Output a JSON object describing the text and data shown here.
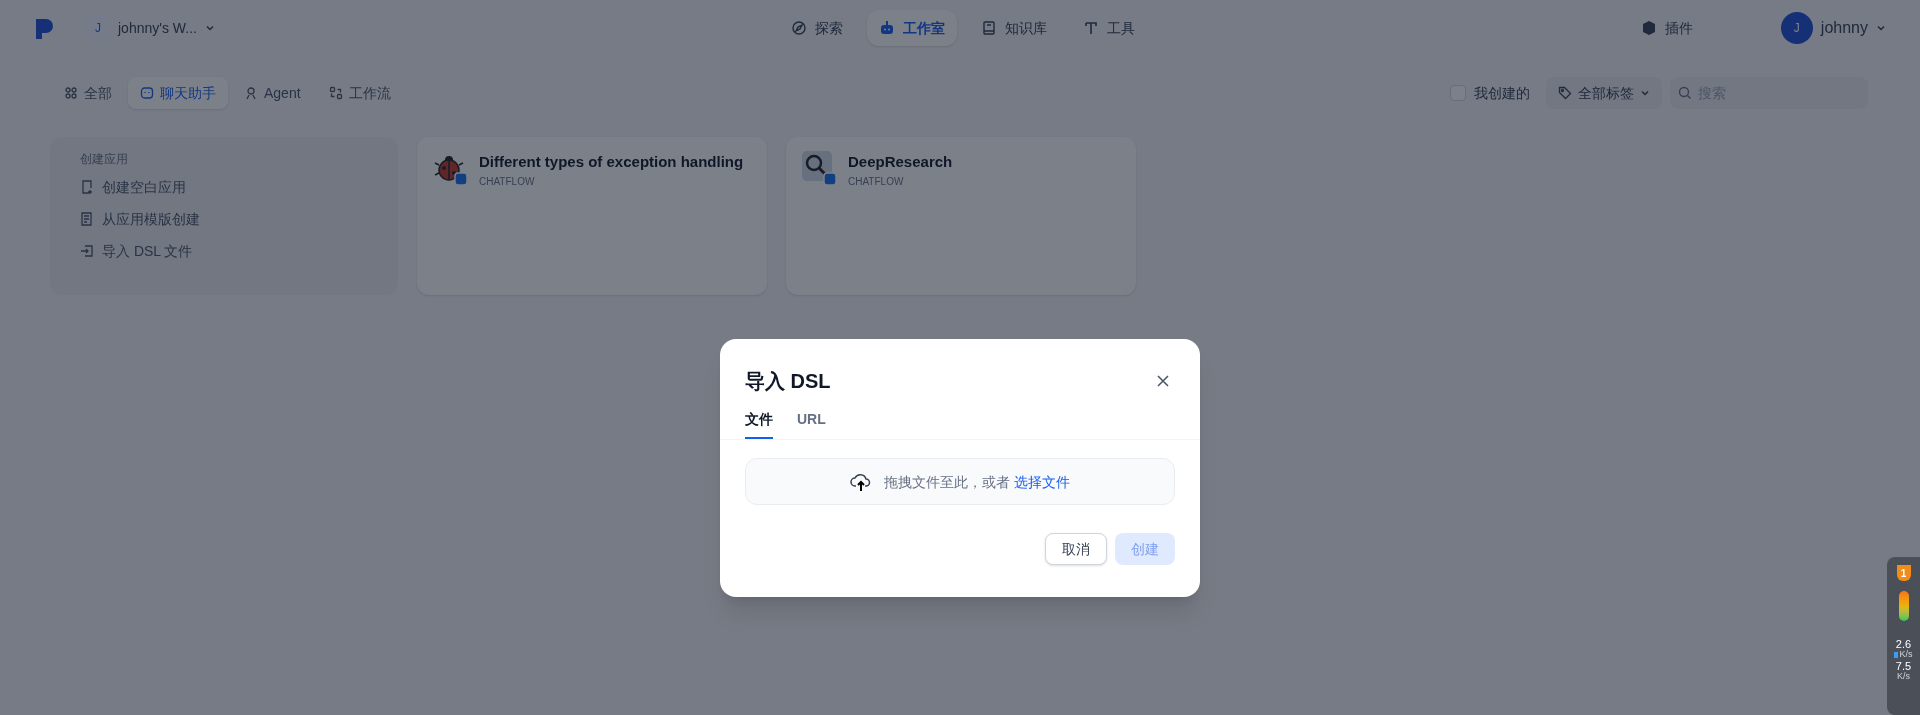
{
  "header": {
    "workspace": {
      "initial": "J",
      "name": "johnny's W..."
    },
    "nav": [
      {
        "label": "探索",
        "selected": false
      },
      {
        "label": "工作室",
        "selected": true
      },
      {
        "label": "知识库",
        "selected": false
      },
      {
        "label": "工具",
        "selected": false
      }
    ],
    "plugins": "插件",
    "user": {
      "initial": "J",
      "name": "johnny"
    }
  },
  "filters": {
    "tabs": [
      {
        "label": "全部",
        "selected": false
      },
      {
        "label": "聊天助手",
        "selected": true
      },
      {
        "label": "Agent",
        "selected": false
      },
      {
        "label": "工作流",
        "selected": false
      }
    ],
    "mine": {
      "label": "我创建的",
      "checked": false
    },
    "tags": "全部标签",
    "search": {
      "placeholder": "搜索"
    }
  },
  "create_card": {
    "title": "创建应用",
    "actions": [
      "创建空白应用",
      "从应用模版创建",
      "导入 DSL 文件"
    ]
  },
  "apps": [
    {
      "name": "Different types of exception handling",
      "type": "CHATFLOW"
    },
    {
      "name": "DeepResearch",
      "type": "CHATFLOW"
    }
  ],
  "dialog": {
    "title": "导入 DSL",
    "tabs": [
      {
        "label": "文件",
        "selected": true
      },
      {
        "label": "URL",
        "selected": false
      }
    ],
    "dropzone": {
      "text": "拖拽文件至此，或者",
      "link": "选择文件"
    },
    "buttons": [
      {
        "label": "取消",
        "kind": "secondary",
        "disabled": false
      },
      {
        "label": "创建",
        "kind": "primary",
        "disabled": true
      }
    ]
  },
  "speed_widget": {
    "badge": "1",
    "up": {
      "value": "2.6",
      "unit": "K/s"
    },
    "down": {
      "value": "7.5",
      "unit": "K/s"
    }
  }
}
